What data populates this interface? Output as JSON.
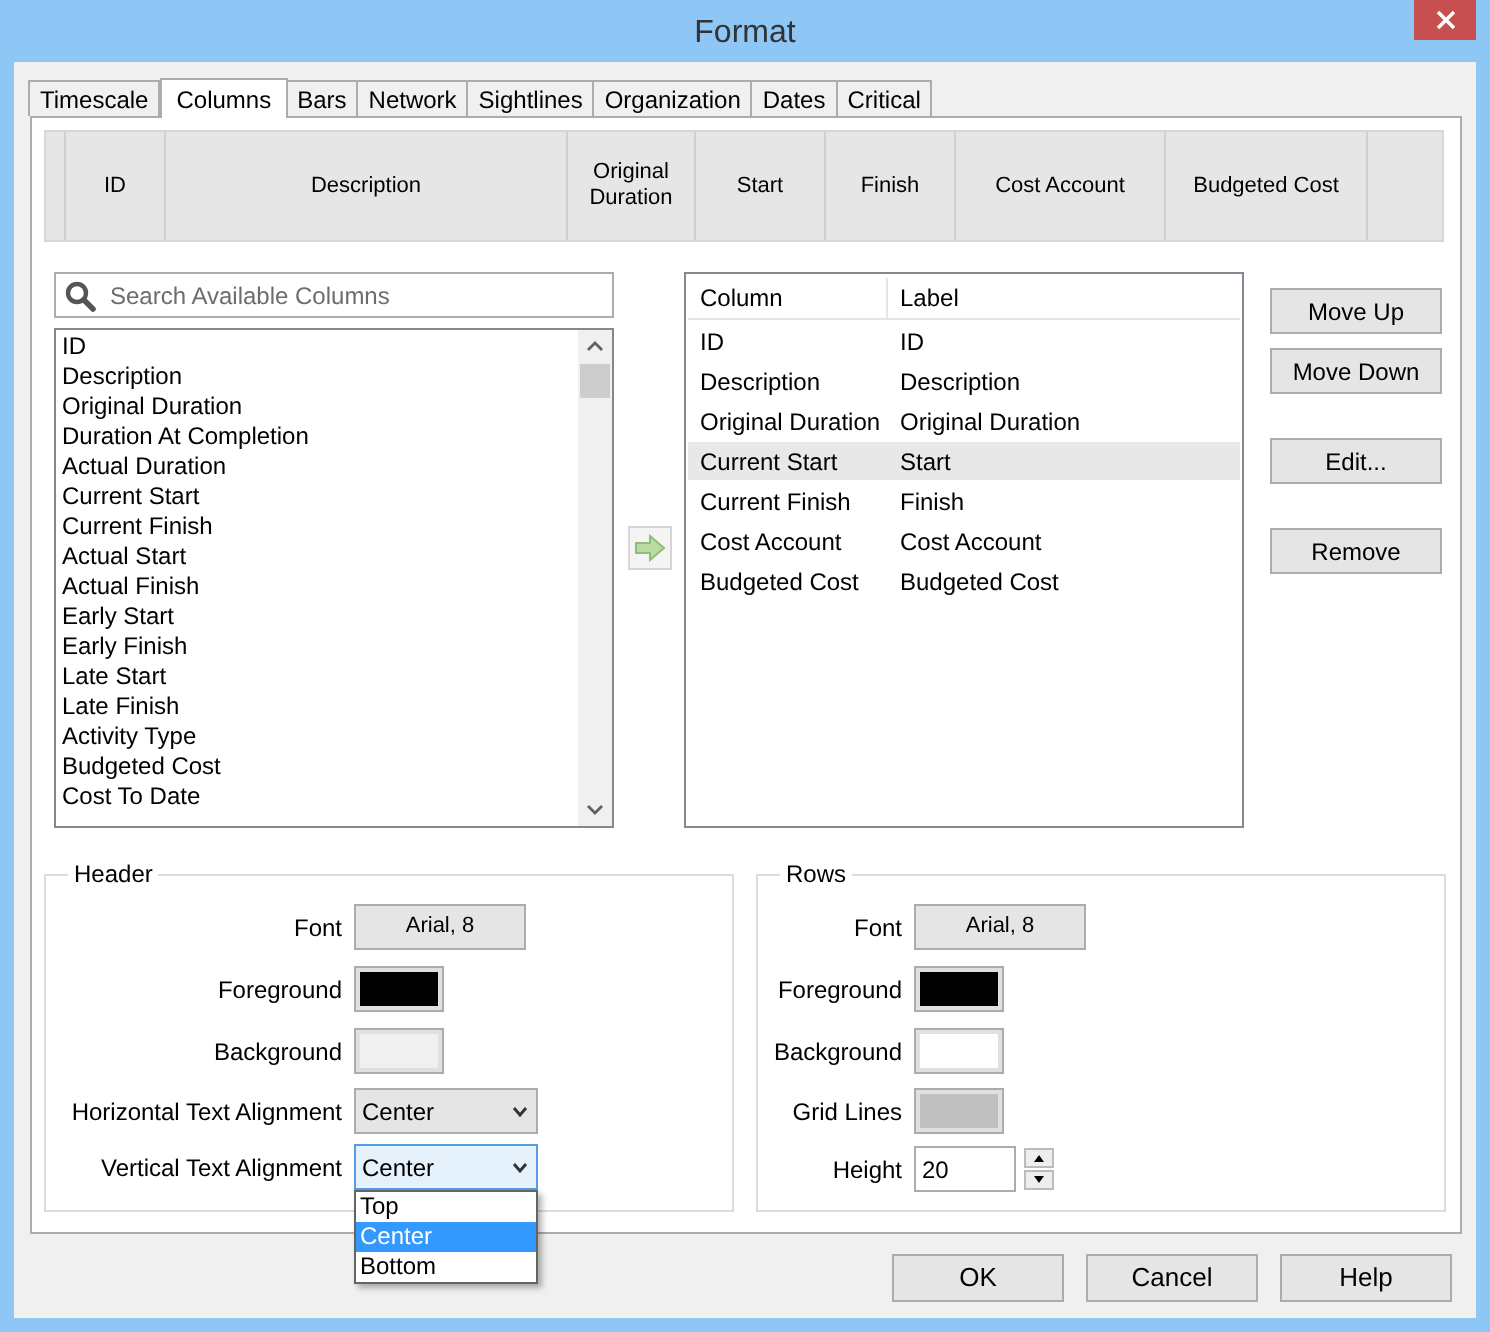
{
  "window": {
    "title": "Format"
  },
  "tabs": [
    {
      "label": "Timescale",
      "selected": false
    },
    {
      "label": "Columns",
      "selected": true
    },
    {
      "label": "Bars",
      "selected": false
    },
    {
      "label": "Network",
      "selected": false
    },
    {
      "label": "Sightlines",
      "selected": false
    },
    {
      "label": "Organization",
      "selected": false
    },
    {
      "label": "Dates",
      "selected": false
    },
    {
      "label": "Critical",
      "selected": false
    }
  ],
  "header_preview": {
    "columns": [
      "ID",
      "Description",
      "Original Duration",
      "Start",
      "Finish",
      "Cost Account",
      "Budgeted Cost"
    ]
  },
  "search": {
    "placeholder": "Search Available Columns"
  },
  "available_columns": [
    "ID",
    "Description",
    "Original Duration",
    "Duration At Completion",
    "Actual Duration",
    "Current Start",
    "Current Finish",
    "Actual Start",
    "Actual Finish",
    "Early Start",
    "Early Finish",
    "Late Start",
    "Late Finish",
    "Activity Type",
    "Budgeted Cost",
    "Cost To Date"
  ],
  "selected_columns": {
    "columns": [
      "Column",
      "Label"
    ],
    "rows": [
      {
        "column": "ID",
        "label": "ID",
        "selected": false
      },
      {
        "column": "Description",
        "label": "Description",
        "selected": false
      },
      {
        "column": "Original Duration",
        "label": "Original Duration",
        "selected": false
      },
      {
        "column": "Current Start",
        "label": "Start",
        "selected": true
      },
      {
        "column": "Current Finish",
        "label": "Finish",
        "selected": false
      },
      {
        "column": "Cost Account",
        "label": "Cost Account",
        "selected": false
      },
      {
        "column": "Budgeted Cost",
        "label": "Budgeted Cost",
        "selected": false
      }
    ]
  },
  "side_buttons": [
    "Move Up",
    "Move Down",
    "Edit...",
    "Remove"
  ],
  "groups": [
    {
      "title": "Header",
      "fields": [
        {
          "kind": "font",
          "label": "Font",
          "value": "Arial, 8"
        },
        {
          "kind": "color",
          "label": "Foreground",
          "color": "#000000"
        },
        {
          "kind": "color",
          "label": "Background",
          "color": "#f0f0f0"
        },
        {
          "kind": "select",
          "label": "Horizontal Text Alignment",
          "value": "Center",
          "expanded": false
        },
        {
          "kind": "select",
          "label": "Vertical Text Alignment",
          "value": "Center",
          "expanded": true,
          "options": [
            {
              "label": "Top",
              "selected": false
            },
            {
              "label": "Center",
              "selected": true
            },
            {
              "label": "Bottom",
              "selected": false
            }
          ]
        }
      ]
    },
    {
      "title": "Rows",
      "fields": [
        {
          "kind": "font",
          "label": "Font",
          "value": "Arial, 8"
        },
        {
          "kind": "color",
          "label": "Foreground",
          "color": "#000000"
        },
        {
          "kind": "color",
          "label": "Background",
          "color": "#ffffff"
        },
        {
          "kind": "color",
          "label": "Grid Lines",
          "color": "#c0c0c0"
        },
        {
          "kind": "spinner",
          "label": "Height",
          "value": "20"
        }
      ]
    }
  ],
  "buttons": [
    "OK",
    "Cancel",
    "Help"
  ]
}
